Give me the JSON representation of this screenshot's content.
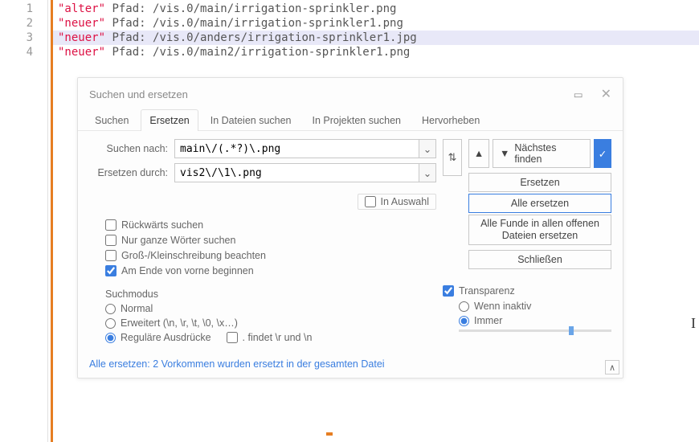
{
  "lines": [
    {
      "n": 1,
      "quoted": "\"alter\"",
      "rest": " Pfad: /vis.0/main/irrigation-sprinkler.png",
      "hl": false
    },
    {
      "n": 2,
      "quoted": "\"neuer\"",
      "rest": " Pfad: /vis.0/main/irrigation-sprinkler1.png",
      "hl": false
    },
    {
      "n": 3,
      "quoted": "\"neuer\"",
      "rest": " Pfad: /vis.0/anders/irrigation-sprinkler1.jpg",
      "hl": true
    },
    {
      "n": 4,
      "quoted": "\"neuer\"",
      "rest": " Pfad: /vis.0/main2/irrigation-sprinkler1.png",
      "hl": false
    }
  ],
  "dialog": {
    "title": "Suchen und ersetzen",
    "tabs": [
      "Suchen",
      "Ersetzen",
      "In Dateien suchen",
      "In Projekten suchen",
      "Hervorheben"
    ],
    "activeTab": 1,
    "search_label": "Suchen nach:",
    "search_value": "main\\/(.*?)\\.png",
    "replace_label": "Ersetzen durch:",
    "replace_value": "vis2\\/\\1\\.png",
    "swap_glyph": "⇅",
    "prev_glyph": "▲",
    "next_glyph": "▼",
    "next_label": "Nächstes finden",
    "check_glyph": "✓",
    "replace_btn": "Ersetzen",
    "in_sel": "In Auswahl",
    "replace_all_btn": "Alle ersetzen",
    "checks": {
      "backwards": "Rückwärts suchen",
      "wholewords": "Nur ganze Wörter suchen",
      "casesens": "Groß-/Kleinschreibung beachten",
      "wrap": "Am Ende von vorne beginnen"
    },
    "all_files_btn": "Alle Funde in allen offenen Dateien ersetzen",
    "close_btn": "Schließen",
    "mode_title": "Suchmodus",
    "modes": {
      "normal": "Normal",
      "extended": "Erweitert (\\n, \\r, \\t, \\0, \\x…)",
      "regex": "Reguläre Ausdrücke",
      "dot_nl": ". findet \\r und \\n"
    },
    "transparency": "Transparenz",
    "trans_inactive": "Wenn inaktiv",
    "trans_always": "Immer",
    "status": "Alle ersetzen: 2 Vorkommen wurden ersetzt in der gesamten Datei",
    "caret_glyph": "∧"
  }
}
